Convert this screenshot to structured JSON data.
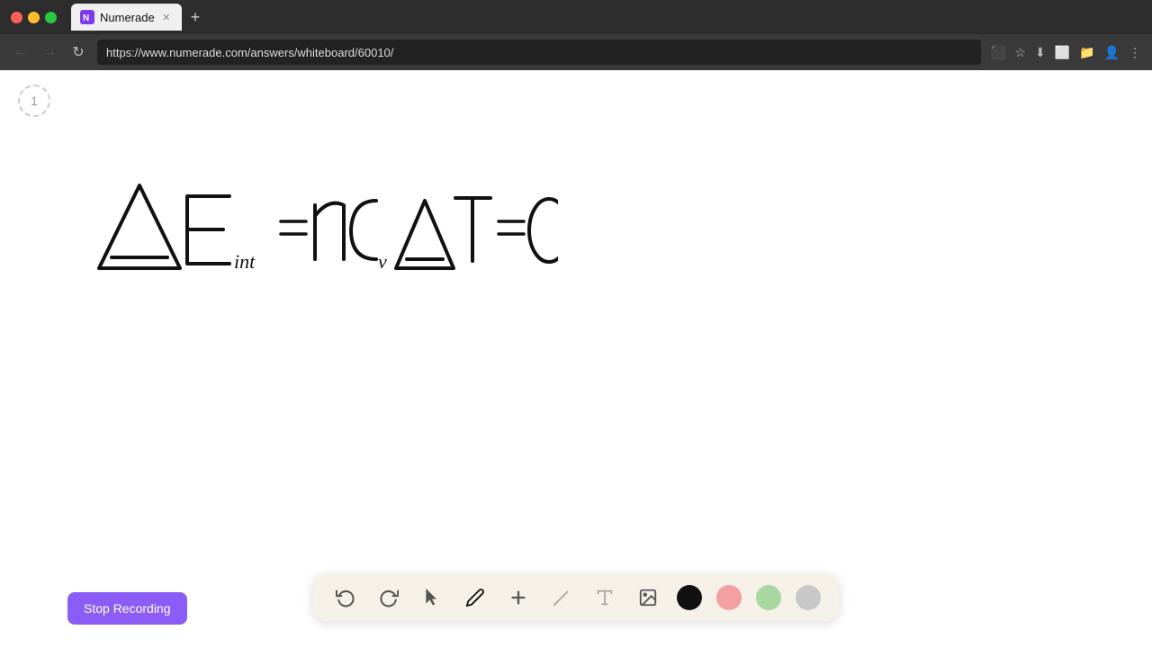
{
  "browser": {
    "title": "Numerade",
    "url": "https://www.numerade.com/answers/whiteboard/60010/",
    "tab_label": "Numerade",
    "new_tab_symbol": "+",
    "nav": {
      "back": "←",
      "forward": "→",
      "refresh": "↻"
    }
  },
  "page_indicator": {
    "number": "1"
  },
  "toolbar": {
    "undo": "↺",
    "redo": "↻",
    "select": "▲",
    "pen": "✏",
    "add": "+",
    "highlighter": "/",
    "text": "T",
    "image": "🖼",
    "colors": [
      "#111111",
      "#f4a0a0",
      "#a8d8a0",
      "#c0c0c0"
    ]
  },
  "stop_recording": {
    "label": "Stop Recording"
  },
  "colors": {
    "black": "#111111",
    "pink": "#f4a0a0",
    "green": "#a8d8a0",
    "gray": "#c0c0c0"
  }
}
